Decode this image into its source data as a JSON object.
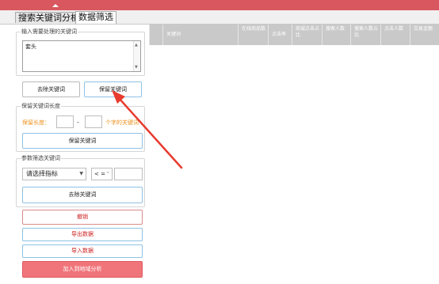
{
  "tabs": [
    {
      "label": "搜索关键词分析"
    },
    {
      "label": "数据筛选"
    }
  ],
  "input_group": {
    "label": "输入需要处理的关键词",
    "textarea_value": "套头"
  },
  "buttons": {
    "remove_keywords": "去除关键词",
    "keep_keywords": "保留关键词"
  },
  "length_group": {
    "label": "保留关键词长度",
    "length_label": "保留长度：",
    "dash": "-",
    "suffix": "个字的关键词",
    "keep_button": "保留关键词"
  },
  "param_group": {
    "label": "参数筛选关键词",
    "indicator_select": "请选择指标",
    "operator_select": "< = '",
    "remove_button": "去除关键词"
  },
  "actions": {
    "undo": "撤销",
    "export": "导出数据",
    "import": "导入数据",
    "add_to_analysis": "加入到地域分析"
  },
  "grid": {
    "columns": [
      "关键词",
      "在线商品数",
      "点击率",
      "商城点击占比",
      "搜索人数",
      "搜索人数占比",
      "点击人数",
      "交易金额"
    ]
  },
  "colors": {
    "titlebar": "#d9575f",
    "accent_orange": "#ee8f1a",
    "primary_button": "#f0757a",
    "grid_header": "#c9c9c9",
    "annotation_arrow": "#e83b2e"
  }
}
